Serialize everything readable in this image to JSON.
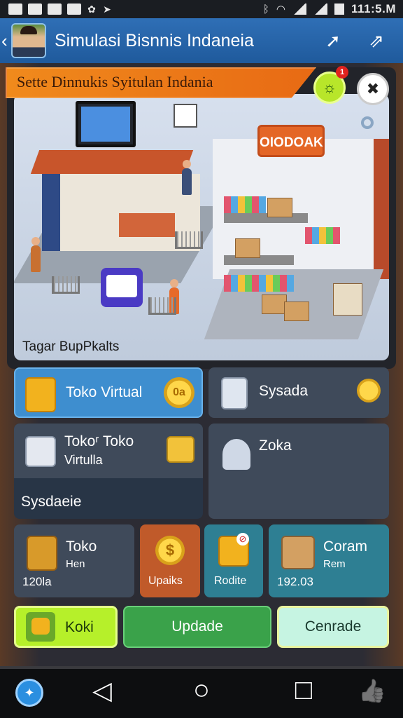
{
  "status_bar": {
    "time": "111:5.M",
    "left_icons": [
      "image-icon",
      "image-icon",
      "home-icon",
      "notification-icon",
      "app-icon",
      "arrow-icon"
    ],
    "right_icons": [
      "bluetooth-icon",
      "wifi-icon",
      "signal-icon",
      "signal-icon",
      "battery-icon"
    ]
  },
  "header": {
    "back_glyph": "‹",
    "title": "Simulasi Bisnnis  Indaneia",
    "action1_glyph": "➚",
    "action2_glyph": "⇗"
  },
  "game": {
    "banner_text": "Sette Dinnukis Syitulan Indania",
    "badge_count": "1",
    "badge_glyph": "☼",
    "close_glyph": "✖",
    "scene_sign": "OIODOAK",
    "scene_caption": "Tagar BupPkalts"
  },
  "menu": {
    "toko_virtual_label": "Toko Virtual",
    "toko_virtual_coin": "0a",
    "sysada_label": "Sysada",
    "toko_toko_label": "Tokoʳ Toko",
    "toko_toko_sub": "Virtulla",
    "sysdaeie_label": "Sysdaeie",
    "zoka_label": "Zoka",
    "toko_hen_label": "Toko",
    "toko_hen_sub": "Hen",
    "toko_hen_value": "120la",
    "upaiks_label": "Upaiks",
    "upaiks_coin": "$",
    "rodite_label": "Rodite",
    "coram_label": "Coram",
    "coram_sub": "Rem",
    "coram_value": "192.03"
  },
  "buttons": {
    "koki_label": "Koki",
    "update_label": "Updade",
    "cenrade_label": "Cenrade"
  },
  "nav": {
    "back_glyph": "◁",
    "home_glyph": "○",
    "recents_glyph": "□",
    "thumbs_glyph": "👍"
  },
  "colors": {
    "header_blue": "#2f6fb6",
    "banner_orange": "#f08a1c",
    "card_blue": "#3e8ecf",
    "card_slate": "#3f4a5a",
    "card_dark": "#283546",
    "card_orange": "#c05a2a",
    "card_teal": "#2e7f93",
    "btn_lime": "#b6f02a",
    "btn_green": "#3aa24a",
    "btn_mint": "#c6f4e2"
  }
}
